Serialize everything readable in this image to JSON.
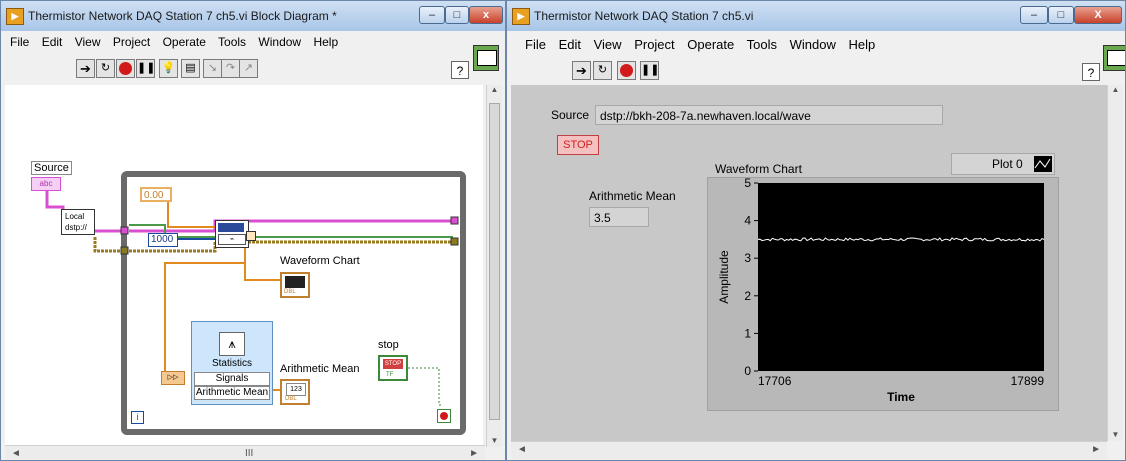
{
  "block_diagram_window": {
    "title": "Thermistor Network DAQ Station 7 ch5.vi Block Diagram *",
    "menu": [
      "File",
      "Edit",
      "View",
      "Project",
      "Operate",
      "Tools",
      "Window",
      "Help"
    ],
    "window_buttons": {
      "minimize": "–",
      "maximize": "□",
      "close": "x"
    },
    "help_label": "?",
    "nodes": {
      "source_label": "Source",
      "source_terminal": "abc",
      "local_label": "Local",
      "local_value": "dstp://",
      "numeric_constant": "0.00",
      "timeout_constant": "1000",
      "waveform_chart_label": "Waveform Chart",
      "statistics_title": "Statistics",
      "statistics_signals": "Signals",
      "statistics_arith": "Arithmetic Mean",
      "arith_mean_label": "Arithmetic Mean",
      "arith_indicator": "123",
      "dbl_badge": "DBL",
      "stop_label": "stop",
      "stop_terminal": "STOP",
      "stop_tf": "TF",
      "loop_iteration": "i"
    },
    "scroll_text": "III"
  },
  "front_panel_window": {
    "title": "Thermistor Network DAQ Station 7 ch5.vi",
    "menu": [
      "File",
      "Edit",
      "View",
      "Project",
      "Operate",
      "Tools",
      "Window",
      "Help"
    ],
    "window_buttons": {
      "minimize": "–",
      "maximize": "□",
      "close": "X"
    },
    "help_label": "?",
    "source_label": "Source",
    "source_value": "dstp://bkh-208-7a.newhaven.local/wave",
    "stop_button": "STOP",
    "arith_mean_label": "Arithmetic Mean",
    "arith_mean_value": "3.5",
    "chart": {
      "title": "Waveform Chart",
      "legend_label": "Plot 0",
      "ylabel": "Amplitude",
      "xlabel": "Time"
    },
    "colors": {
      "panel": "#c8c8c8",
      "plot_bg": "#000000",
      "trace": "#ffffff"
    }
  },
  "chart_data": {
    "type": "line",
    "title": "Waveform Chart",
    "xlabel": "Time",
    "ylabel": "Amplitude",
    "xlim": [
      17706,
      17899
    ],
    "ylim": [
      0,
      5
    ],
    "y_ticks": [
      "0",
      "1",
      "2",
      "3",
      "4",
      "5"
    ],
    "x_ticks": [
      "17706",
      "17899"
    ],
    "series": [
      {
        "name": "Plot 0",
        "approx_constant_value": 3.5
      }
    ]
  }
}
